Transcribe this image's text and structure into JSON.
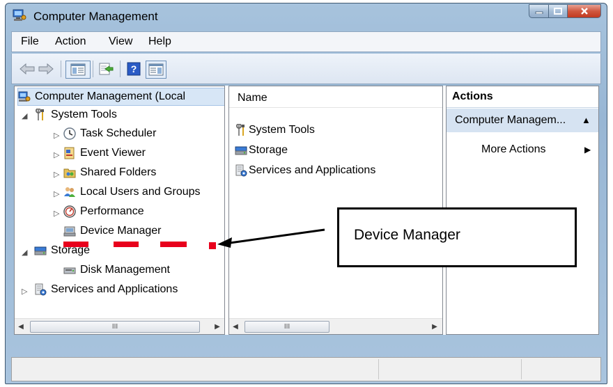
{
  "window": {
    "title": "Computer Management"
  },
  "menu": [
    "File",
    "Action",
    "View",
    "Help"
  ],
  "tree": {
    "root": "Computer Management (Local",
    "items": [
      {
        "label": "System Tools",
        "icon": "tools-icon"
      },
      {
        "label": "Task Scheduler",
        "icon": "clock-icon"
      },
      {
        "label": "Event Viewer",
        "icon": "event-viewer-icon"
      },
      {
        "label": "Shared Folders",
        "icon": "shared-folder-icon"
      },
      {
        "label": "Local Users and Groups",
        "icon": "users-icon"
      },
      {
        "label": "Performance",
        "icon": "performance-icon"
      },
      {
        "label": "Device Manager",
        "icon": "device-manager-icon"
      },
      {
        "label": "Storage",
        "icon": "storage-icon"
      },
      {
        "label": "Disk Management",
        "icon": "disk-icon"
      },
      {
        "label": "Services and Applications",
        "icon": "services-icon"
      }
    ]
  },
  "list": {
    "column_name": "Name",
    "items": [
      "System Tools",
      "Storage",
      "Services and Applications"
    ]
  },
  "actions": {
    "header": "Actions",
    "section": "Computer Managem...",
    "more": "More Actions"
  },
  "scrollbar": {
    "thumb_glyph": "III"
  },
  "annotation": {
    "callout_text": "Device Manager",
    "accent_color": "#e8001c"
  }
}
